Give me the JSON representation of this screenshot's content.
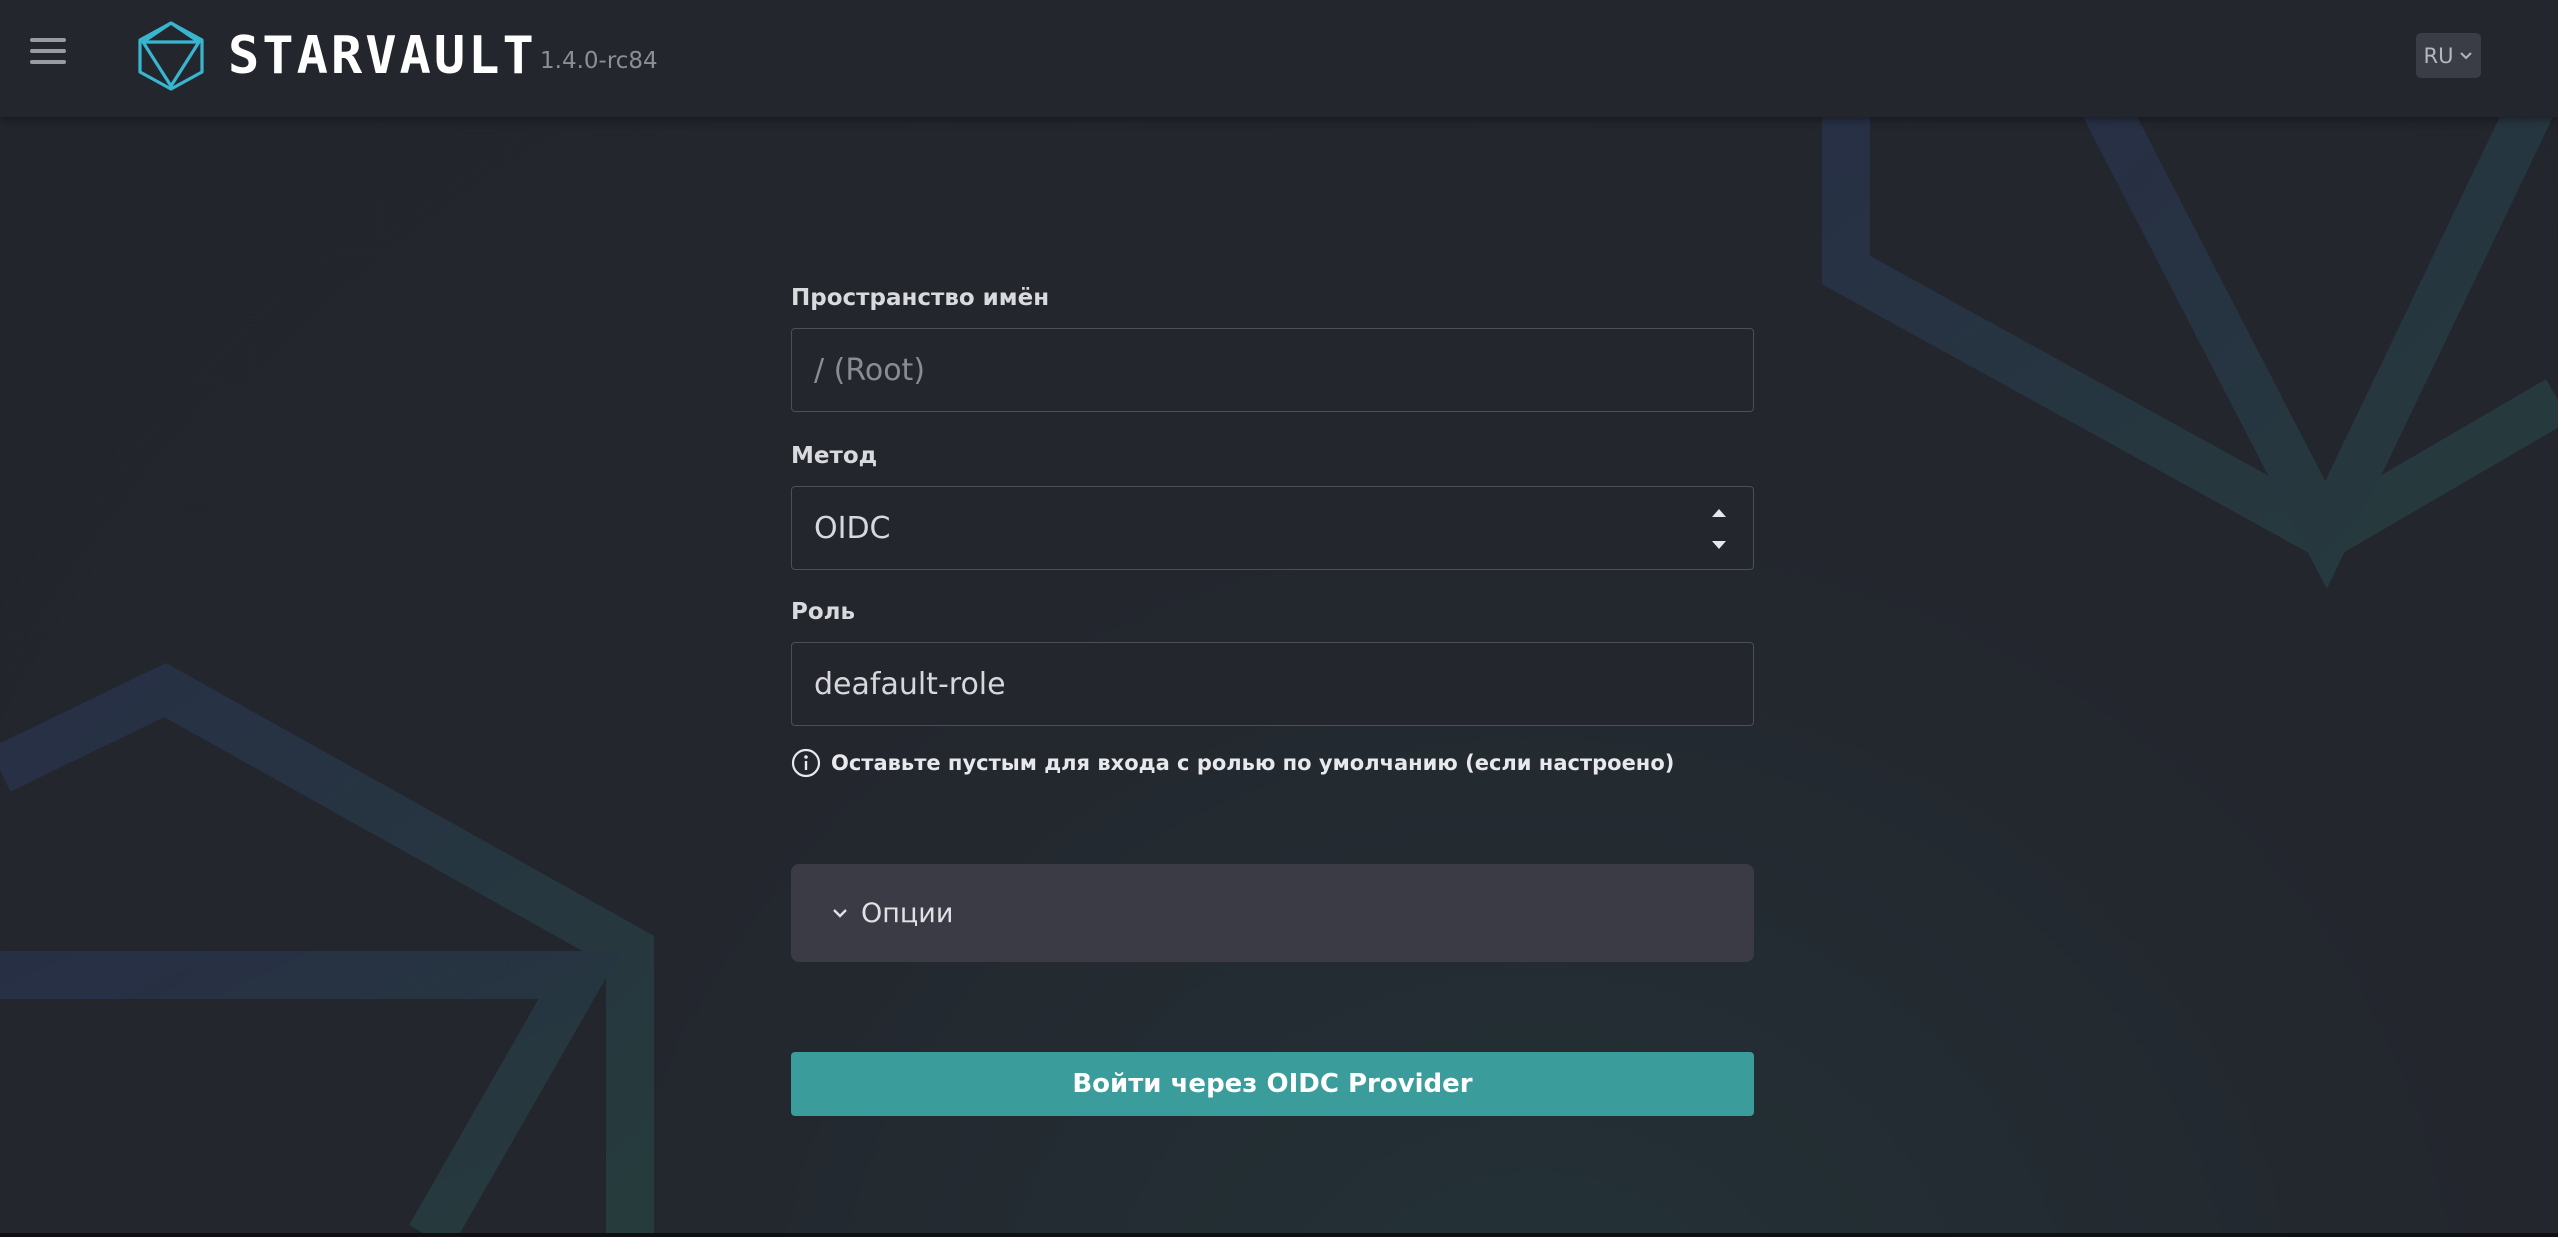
{
  "header": {
    "brand": "STARVAULT",
    "version": "1.4.0-rc84",
    "language": "RU"
  },
  "form": {
    "namespace": {
      "label": "Пространство имён",
      "placeholder": "/ (Root)",
      "value": ""
    },
    "method": {
      "label": "Метод",
      "value": "OIDC"
    },
    "role": {
      "label": "Роль",
      "value": "deafault-role",
      "hint": "Оставьте пустым для входа с ролью по умолчанию (если настроено)"
    },
    "options_label": "Опции",
    "submit_label": "Войти через OIDC Provider"
  },
  "colors": {
    "accent": "#3a9c9b",
    "logo": "#38b6d0",
    "background": "#23252d"
  },
  "icons": [
    "menu-icon",
    "logo-icon",
    "chevron-down-icon",
    "sort-arrows-icon",
    "info-icon"
  ]
}
